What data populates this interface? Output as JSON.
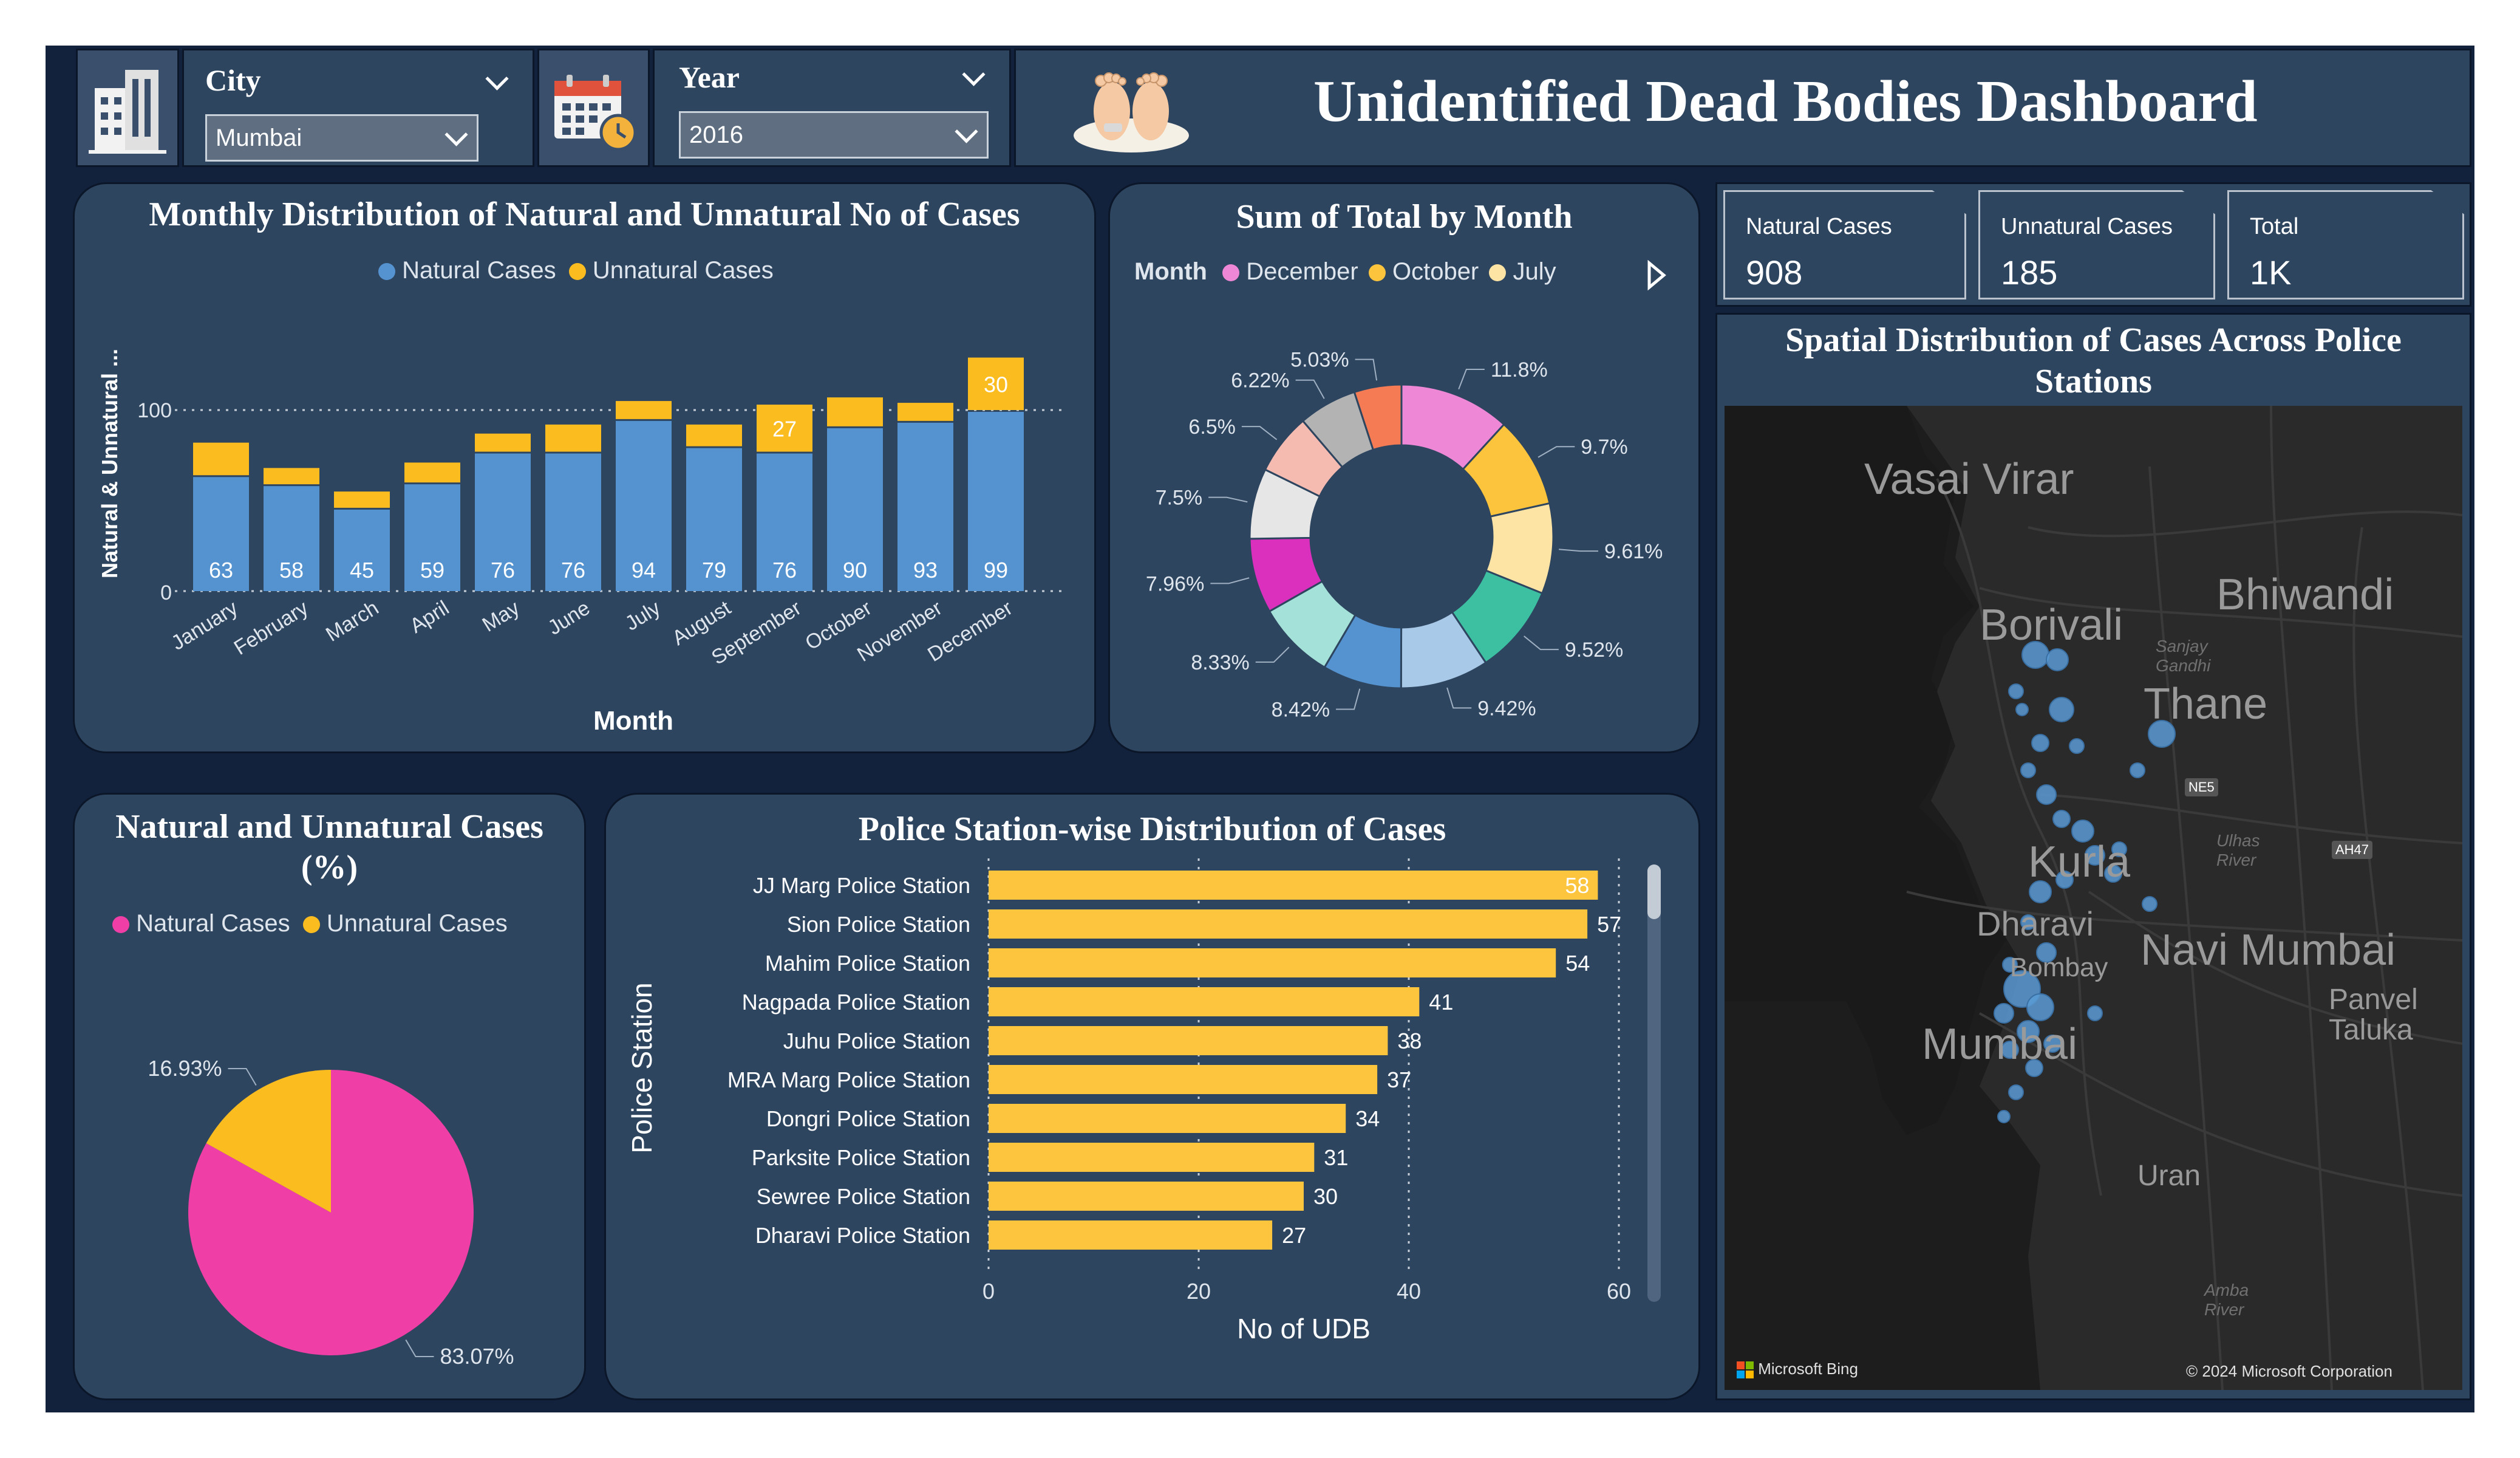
{
  "header": {
    "title": "Unidentified Dead Bodies Dashboard",
    "city_label": "City",
    "city_value": "Mumbai",
    "year_label": "Year",
    "year_value": "2016"
  },
  "kpis": {
    "natural_label": "Natural Cases",
    "natural_value": "908",
    "unnatural_label": "Unnatural Cases",
    "unnatural_value": "185",
    "total_label": "Total",
    "total_value": "1K"
  },
  "monthly": {
    "title": "Monthly Distribution of Natural and Unnatural No of Cases",
    "legend_natural": "Natural Cases",
    "legend_unnatural": "Unnatural Cases",
    "ylabel": "Natural & Unnatural ...",
    "xlabel": "Month",
    "tick_0": "0",
    "tick_100": "100"
  },
  "donut": {
    "title": "Sum of Total by Month",
    "legend_title": "Month",
    "legend_1": "December",
    "legend_2": "October",
    "legend_3": "July"
  },
  "pie": {
    "title": "Natural and Unnatural Cases (%)",
    "legend_natural": "Natural Cases",
    "legend_unnatural": "Unnatural Cases",
    "label_unnatural": "16.93%",
    "label_natural": "83.07%"
  },
  "stations": {
    "title": "Police Station-wise Distribution of Cases",
    "ylabel": "Police Station",
    "xlabel": "No of UDB",
    "ticks": [
      "0",
      "20",
      "40",
      "60"
    ]
  },
  "map": {
    "title": "Spatial Distribution of Cases Across Police Stations",
    "places": [
      "Vasai Virar",
      "Borivali",
      "Bhiwandi",
      "Thane",
      "Kurla",
      "Dharavi",
      "Bombay",
      "Navi Mumbai",
      "Mumbai",
      "Panvel",
      "Taluka",
      "Uran",
      "Sanjay",
      "Gandhi",
      "Ulhas",
      "River",
      "Amba",
      "River",
      "NE5",
      "AH47"
    ],
    "attribution_left": "Microsoft Bing",
    "attribution_right": "© 2024 Microsoft Corporation"
  },
  "chart_data": [
    {
      "type": "bar",
      "stacked": true,
      "title": "Monthly Distribution of Natural and Unnatural No of Cases",
      "categories": [
        "January",
        "February",
        "March",
        "April",
        "May",
        "June",
        "July",
        "August",
        "September",
        "October",
        "November",
        "December"
      ],
      "series": [
        {
          "name": "Natural Cases",
          "color": "#5593d0",
          "values": [
            63,
            58,
            45,
            59,
            76,
            76,
            94,
            79,
            76,
            90,
            93,
            99
          ]
        },
        {
          "name": "Unnatural Cases",
          "color": "#fbbc20",
          "values": [
            19,
            10,
            10,
            12,
            11,
            16,
            11,
            13,
            27,
            17,
            11,
            30
          ]
        }
      ],
      "labels_shown_unnatural": [
        false,
        false,
        false,
        false,
        false,
        false,
        false,
        false,
        true,
        false,
        false,
        true
      ],
      "xlabel": "Month",
      "ylabel": "Natural & Unnatural ...",
      "ylim": [
        0,
        130
      ],
      "gridline": 100
    },
    {
      "type": "pie",
      "donut": true,
      "title": "Sum of Total by Month",
      "slices": [
        {
          "name": "December",
          "value": 11.8,
          "label": "11.8%",
          "color": "#ee88d6"
        },
        {
          "name": "October",
          "value": 9.7,
          "label": "9.7%",
          "color": "#fcc43c"
        },
        {
          "name": "July",
          "value": 9.61,
          "label": "9.61%",
          "color": "#fde4a5"
        },
        {
          "name": "",
          "value": 9.52,
          "label": "9.52%",
          "color": "#3dc0a2"
        },
        {
          "name": "",
          "value": 9.42,
          "label": "9.42%",
          "color": "#a9c9e8"
        },
        {
          "name": "",
          "value": 8.42,
          "label": "8.42%",
          "color": "#5593d0"
        },
        {
          "name": "",
          "value": 8.33,
          "label": "8.33%",
          "color": "#a4e1d8"
        },
        {
          "name": "",
          "value": 7.96,
          "label": "7.96%",
          "color": "#db2fbd"
        },
        {
          "name": "",
          "value": 7.5,
          "label": "7.5%",
          "color": "#e6e6e6"
        },
        {
          "name": "",
          "value": 6.5,
          "label": "6.5%",
          "color": "#f6bbb0"
        },
        {
          "name": "",
          "value": 6.22,
          "label": "6.22%",
          "color": "#b3b3b3"
        },
        {
          "name": "",
          "value": 5.03,
          "label": "5.03%",
          "color": "#f47b53"
        }
      ]
    },
    {
      "type": "pie",
      "title": "Natural and Unnatural Cases (%)",
      "slices": [
        {
          "name": "Natural Cases",
          "value": 83.07,
          "label": "83.07%",
          "color": "#ef3ea6"
        },
        {
          "name": "Unnatural Cases",
          "value": 16.93,
          "label": "16.93%",
          "color": "#fbbc20"
        }
      ]
    },
    {
      "type": "bar",
      "orientation": "horizontal",
      "title": "Police Station-wise Distribution of Cases",
      "categories": [
        "JJ Marg Police Station",
        "Sion Police Station",
        "Mahim Police Station",
        "Nagpada Police Station",
        "Juhu Police Station",
        "MRA Marg Police Station",
        "Dongri Police Station",
        "Parksite Police Station",
        "Sewree Police Station",
        "Dharavi Police Station"
      ],
      "values": [
        58,
        57,
        54,
        41,
        38,
        37,
        34,
        31,
        30,
        27
      ],
      "color": "#fdc43e",
      "xlabel": "No of UDB",
      "ylabel": "Police Station",
      "xlim": [
        0,
        60
      ]
    }
  ]
}
